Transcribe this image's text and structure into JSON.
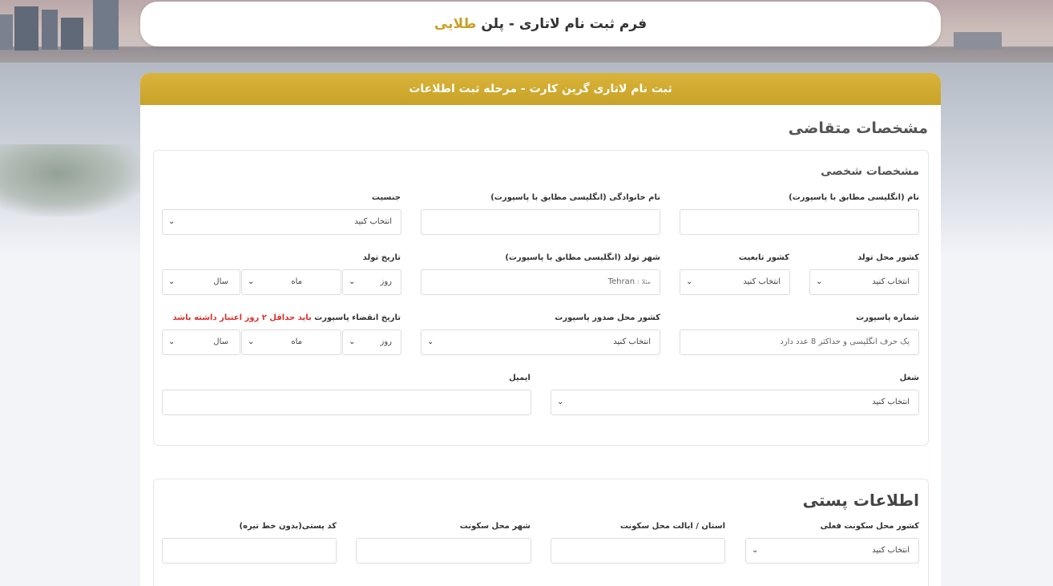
{
  "header": {
    "title_main": "فرم ثبت نام لاتاری - پلن",
    "title_plan": "طلایی"
  },
  "banner": "ثبت نام لاتاری گرین کارت - مرحله ثبت اطلاعات",
  "applicant_section": "مشخصات متقاضی",
  "personal": {
    "title": "مشخصات شخصی",
    "first_name": {
      "label": "نام (انگلیسی مطابق با پاسپورت)",
      "value": ""
    },
    "last_name": {
      "label": "نام خانوادگی (انگلیسی مطابق با پاسپورت)",
      "value": ""
    },
    "gender": {
      "label": "جنسیت",
      "value": "انتخاب کنید"
    },
    "birth_country": {
      "label": "کشور محل تولد",
      "value": "انتخاب کنید"
    },
    "citizenship": {
      "label": "کشور تابعیت",
      "value": "انتخاب کنید"
    },
    "birth_city": {
      "label": "شهر تولد (انگلیسی مطابق با پاسپورت)",
      "placeholder_prefix": "مثلا :",
      "placeholder": "Tehran"
    },
    "birth_date": {
      "label": "تاریخ تولد",
      "day": "روز",
      "month": "ماه",
      "year": "سال"
    },
    "passport_number": {
      "label": "شماره پاسپورت",
      "placeholder": "یک حرف انگلیسی و حداکثر 8 عدد دارد"
    },
    "passport_country": {
      "label": "کشور محل صدور پاسپورت",
      "value": "انتخاب کنید"
    },
    "passport_expiry": {
      "label": "تاریخ انقضاء پاسپورت",
      "warning": "باید حداقل ۲ روز اعتبار داشته باشد",
      "day": "روز",
      "month": "ماه",
      "year": "سال"
    },
    "job": {
      "label": "شغل",
      "value": "انتخاب کنید"
    },
    "email": {
      "label": "ایمیل",
      "value": ""
    }
  },
  "postal": {
    "title": "اطلاعات پستی",
    "residence_country": {
      "label": "کشور محل سکونت فعلی",
      "value": "انتخاب کنید"
    },
    "province": {
      "label": "استان / ایالت محل سکونت",
      "value": ""
    },
    "city": {
      "label": "شهر محل سکونت",
      "value": ""
    },
    "postal_code": {
      "label": "کد پستی(بدون خط تیره)",
      "value": ""
    }
  },
  "colors": {
    "gold": "#c9a227",
    "warning": "#d9302c"
  },
  "icons": {
    "select": "chevron-down-icon"
  }
}
